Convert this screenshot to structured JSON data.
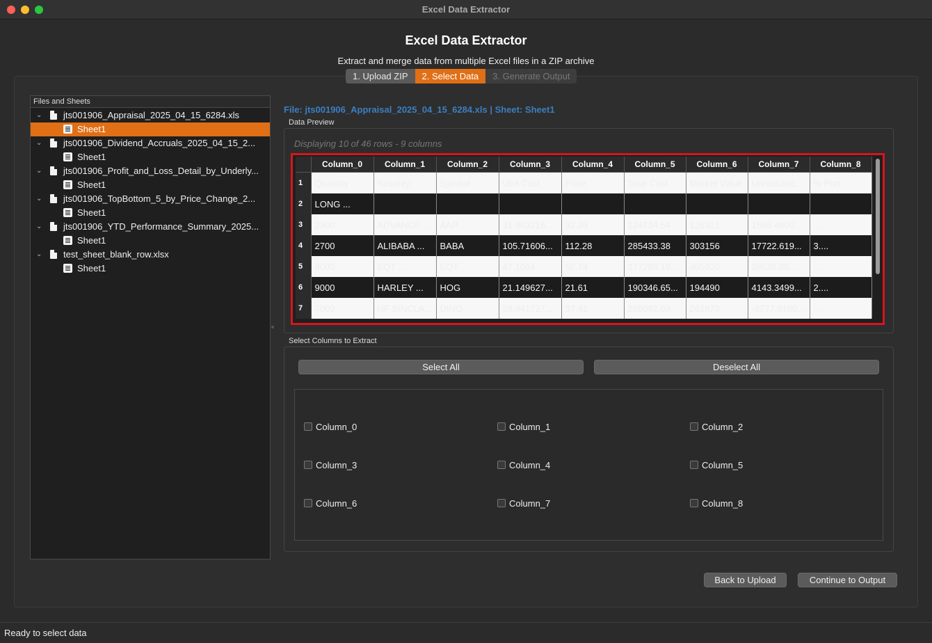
{
  "window": {
    "title": "Excel Data Extractor"
  },
  "header": {
    "title": "Excel Data Extractor",
    "subtitle": "Extract and merge data from multiple Excel files in a ZIP archive"
  },
  "steps": [
    {
      "label": "1. Upload ZIP",
      "state": "done"
    },
    {
      "label": "2. Select Data",
      "state": "active"
    },
    {
      "label": "3. Generate Output",
      "state": "disabled"
    }
  ],
  "tree": {
    "header": "Files and Sheets",
    "files": [
      {
        "name": "jts001906_Appraisal_2025_04_15_6284.xls",
        "sheets": [
          "Sheet1"
        ],
        "selected_sheet": 0
      },
      {
        "name": "jts001906_Dividend_Accruals_2025_04_15_2...",
        "sheets": [
          "Sheet1"
        ]
      },
      {
        "name": "jts001906_Profit_and_Loss_Detail_by_Underly...",
        "sheets": [
          "Sheet1"
        ]
      },
      {
        "name": "jts001906_TopBottom_5_by_Price_Change_2...",
        "sheets": [
          "Sheet1"
        ]
      },
      {
        "name": "jts001906_YTD_Performance_Summary_2025...",
        "sheets": [
          "Sheet1"
        ]
      },
      {
        "name": "test_sheet_blank_row.xlsx",
        "sheets": [
          "Sheet1"
        ]
      }
    ]
  },
  "preview": {
    "file_info": "File: jts001906_Appraisal_2025_04_15_6284.xls | Sheet: Sheet1",
    "title": "Data Preview",
    "info": "Displaying 10 of 46 rows - 9 columns",
    "columns": [
      "Column_0",
      "Column_1",
      "Column_2",
      "Column_3",
      "Column_4",
      "Column_5",
      "Column_6",
      "Column_7",
      "Column_8"
    ],
    "rows": [
      {
        "n": "1",
        "cells": [
          "Quantity",
          "Security",
          "Symbol",
          "Unit Cost",
          "Price",
          "Total Cost",
          "Market Value",
          "Unrealized...",
          "% Port"
        ]
      },
      {
        "n": "2",
        "cells": [
          "LONG ...",
          "",
          "",
          "",
          "",
          "",
          "",
          "",
          ""
        ]
      },
      {
        "n": "3",
        "cells": [
          "2900",
          "ADVANCE ...",
          "AAP",
          "31.963216...",
          "32.39",
          "124734.54",
          "126321",
          "1586.4600...",
          "..."
        ]
      },
      {
        "n": "4",
        "cells": [
          "2700",
          "ALIBABA ...",
          "BABA",
          "105.71606...",
          "112.28",
          "285433.38",
          "303156",
          "17722.619...",
          "3...."
        ]
      },
      {
        "n": "5",
        "cells": [
          "8000",
          "EQT ...",
          "EQT",
          "47.1604",
          "50.74",
          "377283.19...",
          "405920",
          "28636.80...",
          "..."
        ]
      },
      {
        "n": "6",
        "cells": [
          "9000",
          "HARLEY ...",
          "HOG",
          "21.149627...",
          "21.61",
          "190346.65...",
          "194490",
          "4143.3499...",
          "2...."
        ]
      },
      {
        "n": "7",
        "cells": [
          "7000",
          "HF SINCLA...",
          "DINO",
          "38.441727...",
          "37.41",
          "269092.09",
          "261870",
          "-6777.9100...",
          "..."
        ]
      }
    ]
  },
  "columns_section": {
    "title": "Select Columns to Extract",
    "select_all": "Select All",
    "deselect_all": "Deselect All",
    "checkboxes": [
      "Column_0",
      "Column_1",
      "Column_2",
      "Column_3",
      "Column_4",
      "Column_5",
      "Column_6",
      "Column_7",
      "Column_8"
    ]
  },
  "actions": {
    "back": "Back to Upload",
    "continue": "Continue to Output"
  },
  "status": {
    "text": "Ready to select data"
  },
  "colors": {
    "accent": "#e06f15",
    "info_blue": "#3b7fbf",
    "highlight_red": "#d9141c"
  }
}
